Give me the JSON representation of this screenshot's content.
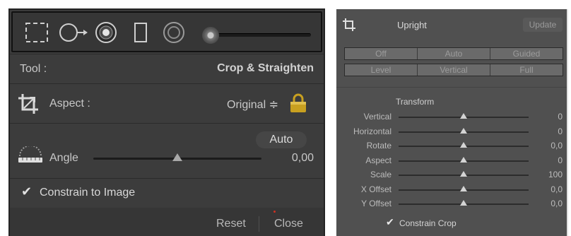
{
  "left_panel": {
    "toolstrip": {
      "icons": [
        "crop-overlay-icon",
        "spot-removal-icon",
        "red-eye-icon",
        "graduated-filter-icon",
        "radial-filter-icon",
        "adjustment-brush-icon"
      ]
    },
    "tool": {
      "label": "Tool :",
      "value": "Crop & Straighten"
    },
    "aspect": {
      "label": "Aspect :",
      "value": "Original ≑"
    },
    "angle": {
      "auto_label": "Auto",
      "label": "Angle",
      "value": "0,00",
      "level": 0.5
    },
    "constrain": {
      "checkmark": "✔",
      "label": "Constrain to Image",
      "checked": true
    },
    "footer": {
      "reset": "Reset",
      "close": "Close"
    }
  },
  "right_panel": {
    "title": "Upright",
    "update": "Update",
    "upright_modes_row1": [
      "Off",
      "Auto",
      "Guided"
    ],
    "upright_modes_row2": [
      "Level",
      "Vertical",
      "Full"
    ],
    "transform_title": "Transform",
    "sliders": [
      {
        "label": "Vertical",
        "value": "0",
        "level": 0.5
      },
      {
        "label": "Horizontal",
        "value": "0",
        "level": 0.5
      },
      {
        "label": "Rotate",
        "value": "0,0",
        "level": 0.5
      },
      {
        "label": "Aspect",
        "value": "0",
        "level": 0.5
      },
      {
        "label": "Scale",
        "value": "100",
        "level": 0.5
      },
      {
        "label": "X Offset",
        "value": "0,0",
        "level": 0.5
      },
      {
        "label": "Y Offset",
        "value": "0,0",
        "level": 0.5
      }
    ],
    "constrain_crop": {
      "checkmark": "✔",
      "label": "Constrain Crop",
      "checked": true
    }
  },
  "colors": {
    "panel_dark": "#3c3c3c",
    "panel_light": "#505050",
    "text": "#c8c8c8",
    "lock": "#c8a020"
  }
}
